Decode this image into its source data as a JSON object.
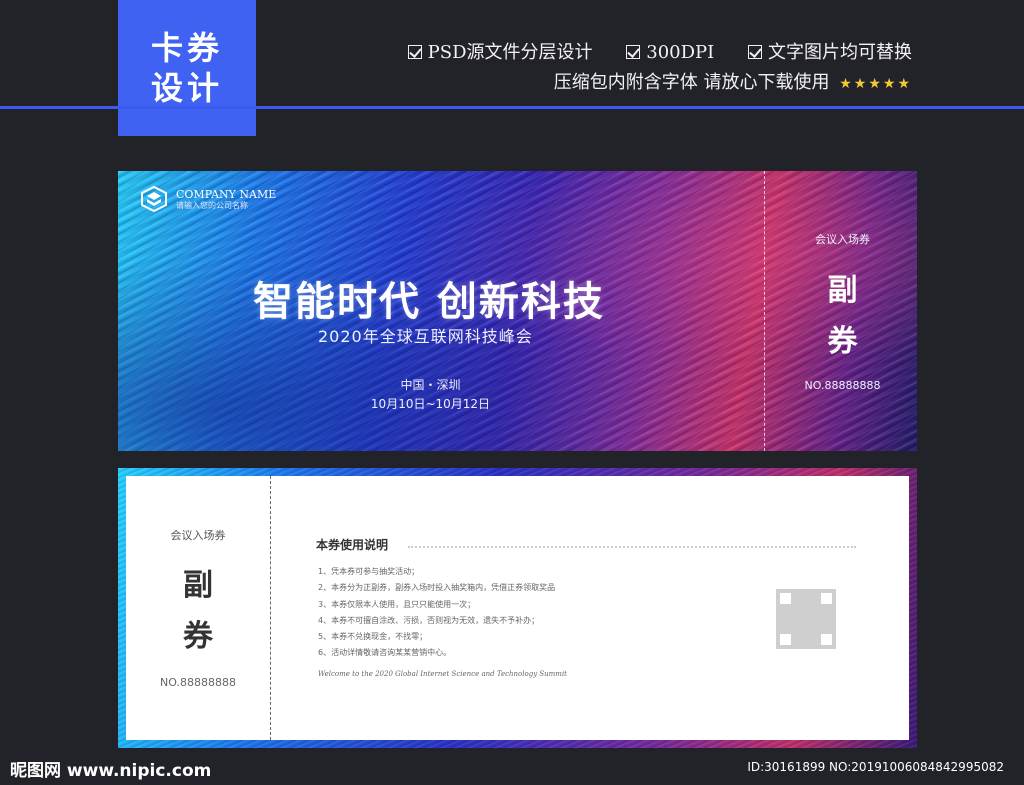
{
  "badge": {
    "line1": "卡券",
    "line2": "设计"
  },
  "features": {
    "row1": [
      "PSD源文件分层设计",
      "300DPI",
      "文字图片均可替换"
    ],
    "row2": "压缩包内附含字体 请放心下载使用",
    "stars": "★★★★★"
  },
  "front": {
    "company_name": "COMPANY NAME",
    "company_sub": "请输入您的公司名称",
    "headline": "智能时代 创新科技",
    "subhead": "2020年全球互联网科技峰会",
    "location": "中国・深圳",
    "dates": "10月10日~10月12日",
    "stub_label": "会议入场券",
    "stub_big1": "副",
    "stub_big2": "券",
    "stub_no": "NO.88888888"
  },
  "back": {
    "stub_label": "会议入场券",
    "stub_big1": "副",
    "stub_big2": "券",
    "stub_no": "NO.88888888",
    "rules_title": "本券使用说明",
    "rules": [
      "1、凭本券可参与抽奖活动；",
      "2、本券分为正副券，副券入场时投入抽奖箱内，凭借正券领取奖品",
      "3、本券仅限本人使用，且只只能使用一次；",
      "4、本券不可擅自涂改、污损，否则视为无效，遗失不予补办；",
      "5、本券不兑换现金，不找零；",
      "6、活动详情敬请咨询某某营销中心。"
    ],
    "welcome": "Welcome to the 2020 Global Internet Science and Technology Summit"
  },
  "watermark": {
    "left": "昵图网 www.nipic.com",
    "right": "ID:30161899 NO:20191006084842995082"
  },
  "colors": {
    "accent": "#3f62f2",
    "background": "#222229",
    "stars": "#f3c931"
  }
}
